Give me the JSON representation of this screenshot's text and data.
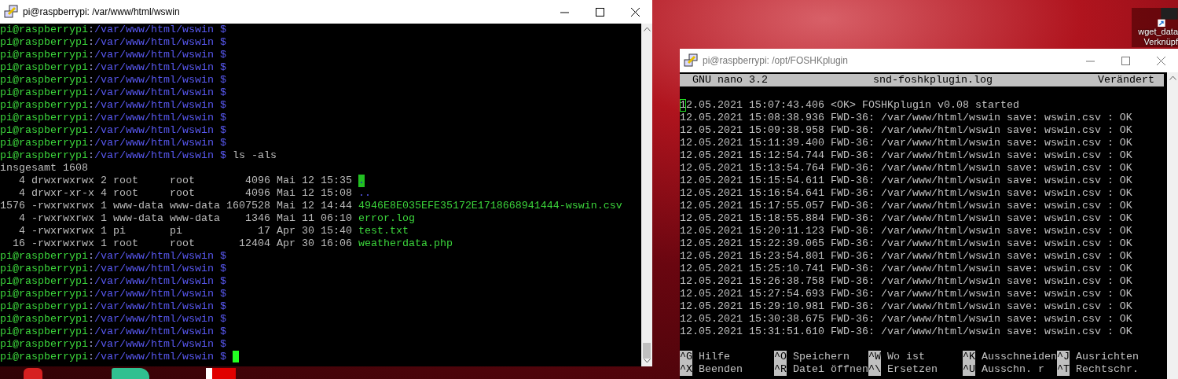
{
  "desktop": {
    "shortcut": {
      "name_lines": [
        "wget_data",
        "Verknüpf"
      ]
    }
  },
  "prompt_separator": ":",
  "terminal_window": {
    "title": "pi@raspberrypi: /var/www/html/wswin",
    "lines": [
      {
        "kind": "prompt",
        "user": "pi@raspberrypi",
        "path": "/var/www/html/wswin",
        "symbol": "$",
        "cursor": false
      },
      {
        "kind": "prompt",
        "user": "pi@raspberrypi",
        "path": "/var/www/html/wswin",
        "symbol": "$",
        "cursor": false
      },
      {
        "kind": "prompt",
        "user": "pi@raspberrypi",
        "path": "/var/www/html/wswin",
        "symbol": "$",
        "cursor": false
      },
      {
        "kind": "prompt",
        "user": "pi@raspberrypi",
        "path": "/var/www/html/wswin",
        "symbol": "$",
        "cursor": false
      },
      {
        "kind": "prompt",
        "user": "pi@raspberrypi",
        "path": "/var/www/html/wswin",
        "symbol": "$",
        "cursor": false
      },
      {
        "kind": "prompt",
        "user": "pi@raspberrypi",
        "path": "/var/www/html/wswin",
        "symbol": "$",
        "cursor": false
      },
      {
        "kind": "prompt",
        "user": "pi@raspberrypi",
        "path": "/var/www/html/wswin",
        "symbol": "$",
        "cursor": false
      },
      {
        "kind": "prompt",
        "user": "pi@raspberrypi",
        "path": "/var/www/html/wswin",
        "symbol": "$",
        "cursor": false
      },
      {
        "kind": "prompt",
        "user": "pi@raspberrypi",
        "path": "/var/www/html/wswin",
        "symbol": "$",
        "cursor": false
      },
      {
        "kind": "prompt",
        "user": "pi@raspberrypi",
        "path": "/var/www/html/wswin",
        "symbol": "$",
        "cursor": false
      },
      {
        "kind": "prompt",
        "user": "pi@raspberrypi",
        "path": "/var/www/html/wswin",
        "symbol": "$",
        "command": "ls -als",
        "cursor": false
      },
      {
        "kind": "output",
        "text": "insgesamt 1608"
      },
      {
        "kind": "listing",
        "blocks": "4",
        "perms": "drwxrwxrwx",
        "links": "2",
        "owner": "root",
        "group": "root",
        "size": "4096",
        "date": "Mai 12 15:35",
        "name": "."
      },
      {
        "kind": "listing",
        "blocks": "4",
        "perms": "drwxr-xr-x",
        "links": "4",
        "owner": "root",
        "group": "root",
        "size": "4096",
        "date": "Mai 12 15:08",
        "name": ".."
      },
      {
        "kind": "listing",
        "blocks": "1576",
        "perms": "-rwxrwxrwx",
        "links": "1",
        "owner": "www-data",
        "group": "www-data",
        "size": "1607528",
        "date": "Mai 12 14:44",
        "name": "4946E8E035EFE35172E1718668941444-wswin.csv"
      },
      {
        "kind": "listing",
        "blocks": "4",
        "perms": "-rwxrwxrwx",
        "links": "1",
        "owner": "www-data",
        "group": "www-data",
        "size": "1346",
        "date": "Mai 11 06:10",
        "name": "error.log"
      },
      {
        "kind": "listing",
        "blocks": "4",
        "perms": "-rwxrwxrwx",
        "links": "1",
        "owner": "pi",
        "group": "pi",
        "size": "17",
        "date": "Apr 30 15:40",
        "name": "test.txt"
      },
      {
        "kind": "listing",
        "blocks": "16",
        "perms": "-rwxrwxrwx",
        "links": "1",
        "owner": "root",
        "group": "root",
        "size": "12404",
        "date": "Apr 30 16:06",
        "name": "weatherdata.php"
      },
      {
        "kind": "prompt",
        "user": "pi@raspberrypi",
        "path": "/var/www/html/wswin",
        "symbol": "$",
        "cursor": false
      },
      {
        "kind": "prompt",
        "user": "pi@raspberrypi",
        "path": "/var/www/html/wswin",
        "symbol": "$",
        "cursor": false
      },
      {
        "kind": "prompt",
        "user": "pi@raspberrypi",
        "path": "/var/www/html/wswin",
        "symbol": "$",
        "cursor": false
      },
      {
        "kind": "prompt",
        "user": "pi@raspberrypi",
        "path": "/var/www/html/wswin",
        "symbol": "$",
        "cursor": false
      },
      {
        "kind": "prompt",
        "user": "pi@raspberrypi",
        "path": "/var/www/html/wswin",
        "symbol": "$",
        "cursor": false
      },
      {
        "kind": "prompt",
        "user": "pi@raspberrypi",
        "path": "/var/www/html/wswin",
        "symbol": "$",
        "cursor": false
      },
      {
        "kind": "prompt",
        "user": "pi@raspberrypi",
        "path": "/var/www/html/wswin",
        "symbol": "$",
        "cursor": false
      },
      {
        "kind": "prompt",
        "user": "pi@raspberrypi",
        "path": "/var/www/html/wswin",
        "symbol": "$",
        "cursor": false
      },
      {
        "kind": "prompt",
        "user": "pi@raspberrypi",
        "path": "/var/www/html/wswin",
        "symbol": "$",
        "cursor": true
      }
    ]
  },
  "nano_window": {
    "title": "pi@raspberrypi: /opt/FOSHKplugin",
    "header": {
      "app": "GNU nano 3.2",
      "file": "snd-foshkplugin.log",
      "status": "Verändert"
    },
    "lines": [
      {
        "text": "12.05.2021 15:07:43.406 <OK> FOSHKplugin v0.08 started",
        "cursor": true
      },
      {
        "text": "12.05.2021 15:08:38.936 FWD-36: /var/www/html/wswin save: wswin.csv : OK",
        "cursor": false
      },
      {
        "text": "12.05.2021 15:09:38.958 FWD-36: /var/www/html/wswin save: wswin.csv : OK",
        "cursor": false
      },
      {
        "text": "12.05.2021 15:11:39.400 FWD-36: /var/www/html/wswin save: wswin.csv : OK",
        "cursor": false
      },
      {
        "text": "12.05.2021 15:12:54.744 FWD-36: /var/www/html/wswin save: wswin.csv : OK",
        "cursor": false
      },
      {
        "text": "12.05.2021 15:13:54.764 FWD-36: /var/www/html/wswin save: wswin.csv : OK",
        "cursor": false
      },
      {
        "text": "12.05.2021 15:15:54.611 FWD-36: /var/www/html/wswin save: wswin.csv : OK",
        "cursor": false
      },
      {
        "text": "12.05.2021 15:16:54.641 FWD-36: /var/www/html/wswin save: wswin.csv : OK",
        "cursor": false
      },
      {
        "text": "12.05.2021 15:17:55.057 FWD-36: /var/www/html/wswin save: wswin.csv : OK",
        "cursor": false
      },
      {
        "text": "12.05.2021 15:18:55.884 FWD-36: /var/www/html/wswin save: wswin.csv : OK",
        "cursor": false
      },
      {
        "text": "12.05.2021 15:20:11.123 FWD-36: /var/www/html/wswin save: wswin.csv : OK",
        "cursor": false
      },
      {
        "text": "12.05.2021 15:22:39.065 FWD-36: /var/www/html/wswin save: wswin.csv : OK",
        "cursor": false
      },
      {
        "text": "12.05.2021 15:23:54.801 FWD-36: /var/www/html/wswin save: wswin.csv : OK",
        "cursor": false
      },
      {
        "text": "12.05.2021 15:25:10.741 FWD-36: /var/www/html/wswin save: wswin.csv : OK",
        "cursor": false
      },
      {
        "text": "12.05.2021 15:26:38.758 FWD-36: /var/www/html/wswin save: wswin.csv : OK",
        "cursor": false
      },
      {
        "text": "12.05.2021 15:27:54.693 FWD-36: /var/www/html/wswin save: wswin.csv : OK",
        "cursor": false
      },
      {
        "text": "12.05.2021 15:29:10.981 FWD-36: /var/www/html/wswin save: wswin.csv : OK",
        "cursor": false
      },
      {
        "text": "12.05.2021 15:30:38.675 FWD-36: /var/www/html/wswin save: wswin.csv : OK",
        "cursor": false
      },
      {
        "text": "12.05.2021 15:31:51.610 FWD-36: /var/www/html/wswin save: wswin.csv : OK",
        "cursor": false
      }
    ],
    "shortcuts": [
      {
        "key": "^G",
        "label": "Hilfe"
      },
      {
        "key": "^O",
        "label": "Speichern"
      },
      {
        "key": "^W",
        "label": "Wo ist"
      },
      {
        "key": "^K",
        "label": "Ausschneiden"
      },
      {
        "key": "^J",
        "label": "Ausrichten"
      },
      {
        "key": "^X",
        "label": "Beenden"
      },
      {
        "key": "^R",
        "label": "Datei öffnen"
      },
      {
        "key": "^\\",
        "label": "Ersetzen"
      },
      {
        "key": "^U",
        "label": "Ausschn. r"
      },
      {
        "key": "^T",
        "label": "Rechtschr."
      }
    ]
  }
}
